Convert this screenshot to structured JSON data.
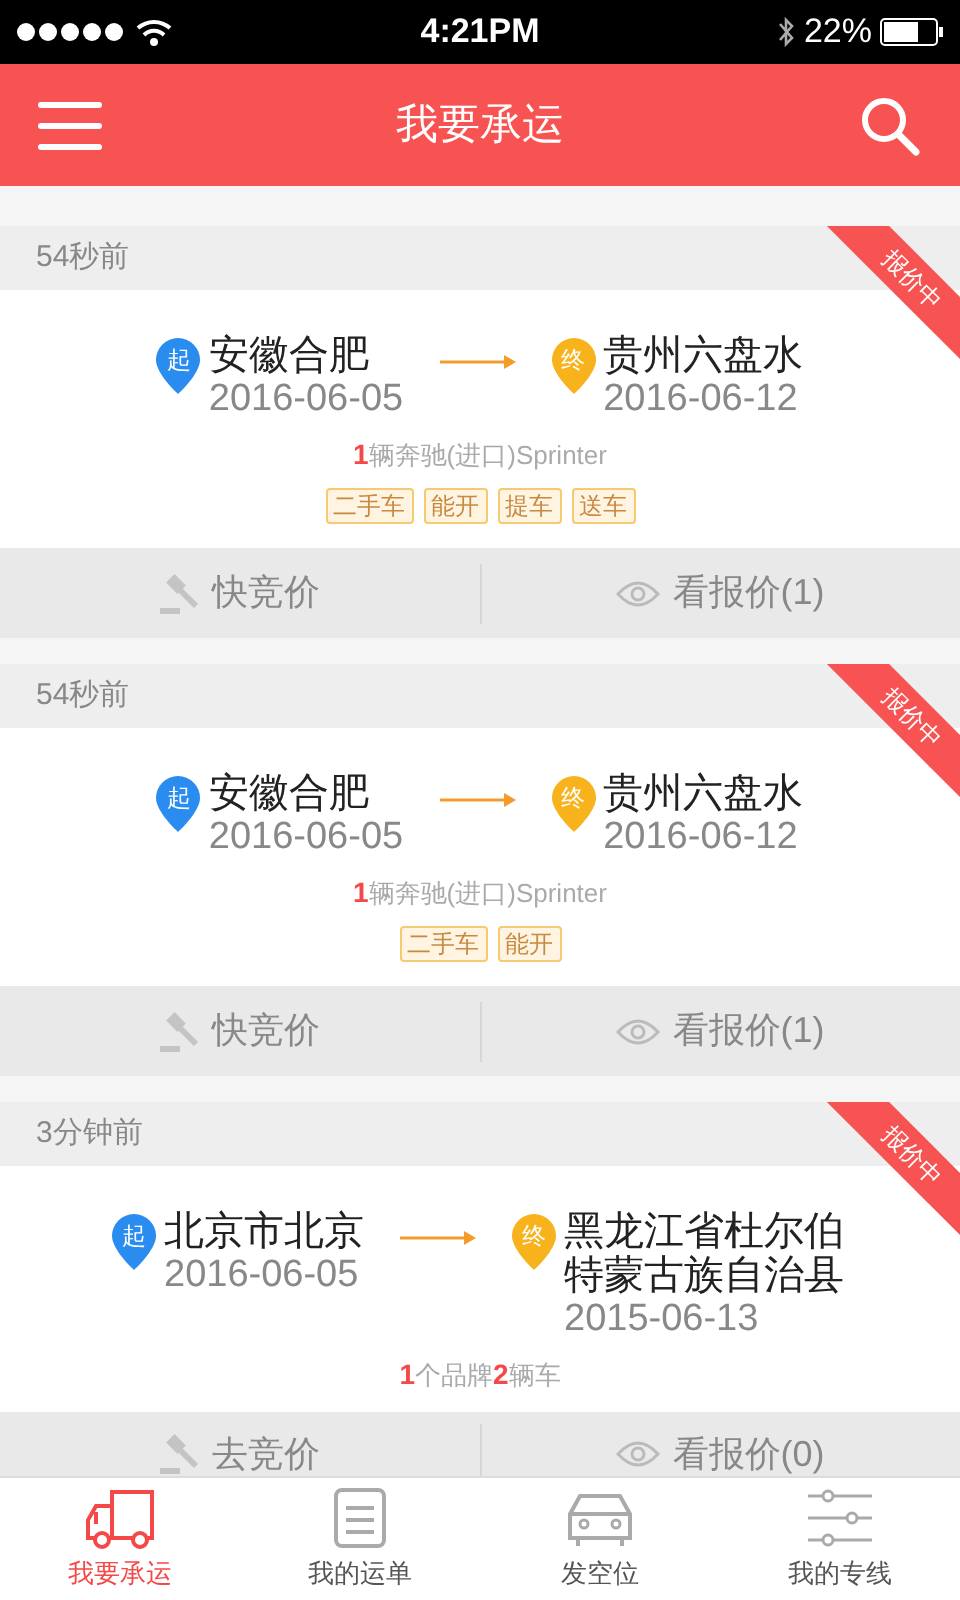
{
  "status_bar": {
    "time": "4:21PM",
    "battery": "22%"
  },
  "header": {
    "title": "我要承运"
  },
  "orders": [
    {
      "time": "54秒前",
      "ribbon": "报价中",
      "from": {
        "badge": "起",
        "place": "安徽合肥",
        "date": "2016-06-05"
      },
      "to": {
        "badge": "终",
        "place": "贵州六盘水",
        "date": "2016-06-12"
      },
      "summary": [
        {
          "text": "1",
          "highlight": true
        },
        {
          "text": "辆奔驰(进口)Sprinter",
          "highlight": false
        }
      ],
      "tags": [
        "二手车",
        "能开",
        "提车",
        "送车"
      ],
      "bid_button": "快竞价",
      "quotes_button": "看报价(1)"
    },
    {
      "time": "54秒前",
      "ribbon": "报价中",
      "from": {
        "badge": "起",
        "place": "安徽合肥",
        "date": "2016-06-05"
      },
      "to": {
        "badge": "终",
        "place": "贵州六盘水",
        "date": "2016-06-12"
      },
      "summary": [
        {
          "text": "1",
          "highlight": true
        },
        {
          "text": "辆奔驰(进口)Sprinter",
          "highlight": false
        }
      ],
      "tags": [
        "二手车",
        "能开"
      ],
      "bid_button": "快竞价",
      "quotes_button": "看报价(1)"
    },
    {
      "time": "3分钟前",
      "ribbon": "报价中",
      "from": {
        "badge": "起",
        "place": "北京市北京",
        "date": "2016-06-05"
      },
      "to": {
        "badge": "终",
        "place": "黑龙江省杜尔伯特蒙古族自治县",
        "date": "2015-06-13"
      },
      "summary": [
        {
          "text": "1",
          "highlight": true
        },
        {
          "text": "个品牌",
          "highlight": false
        },
        {
          "text": "2",
          "highlight": true
        },
        {
          "text": "辆车",
          "highlight": false
        }
      ],
      "bid_button": "去竞价",
      "quotes_button": "看报价(0)"
    }
  ],
  "tab_bar": [
    {
      "label": "我要承运",
      "kind": "truck",
      "selected": true
    },
    {
      "label": "我的运单",
      "kind": "clipboard",
      "selected": false
    },
    {
      "label": "发空位",
      "kind": "car",
      "selected": false
    },
    {
      "label": "我的专线",
      "kind": "sliders",
      "selected": false
    }
  ]
}
